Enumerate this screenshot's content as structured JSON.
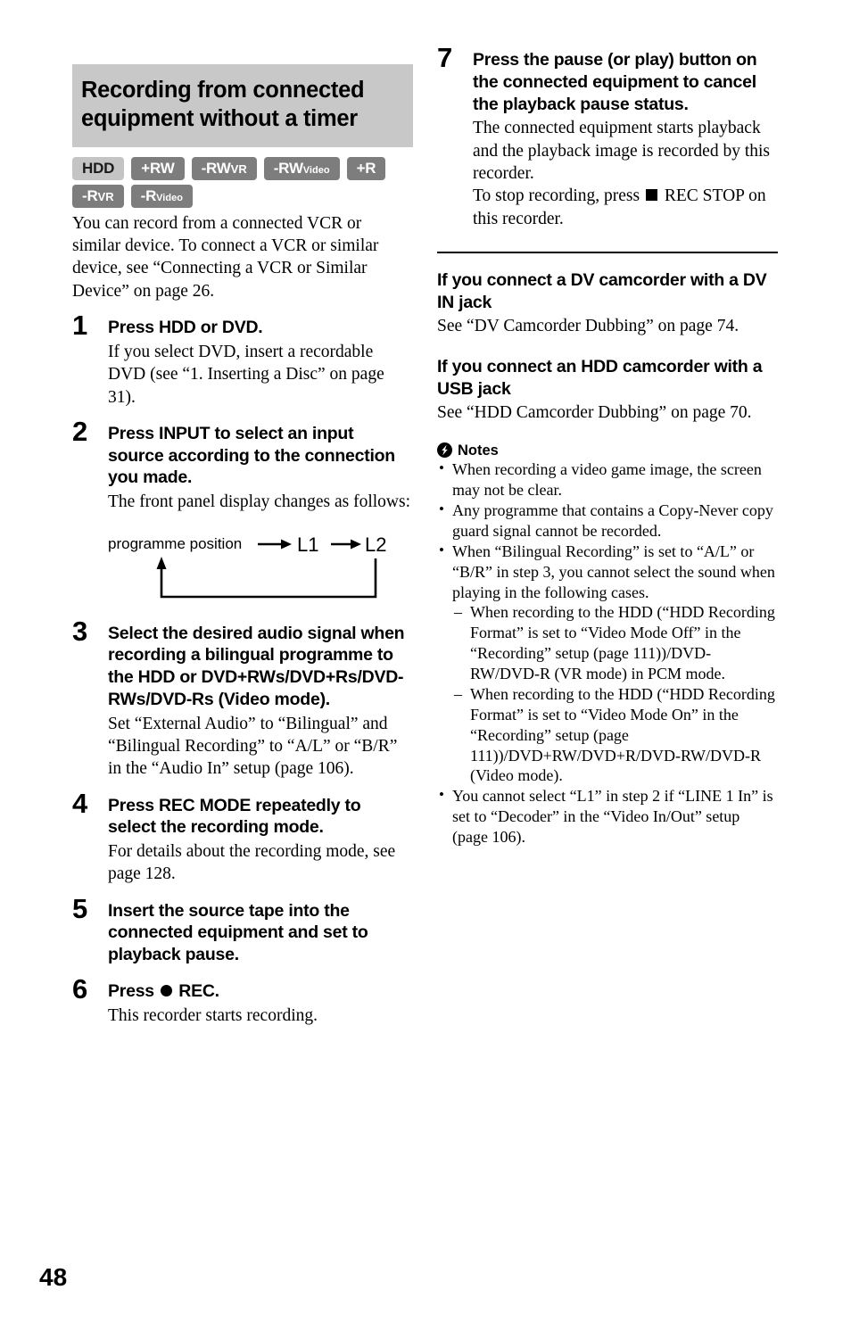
{
  "document": {
    "page_number": "48",
    "title": "Recording from connected equipment without a timer"
  },
  "media_badges": {
    "row1": [
      {
        "main": "HDD",
        "sub": "",
        "style": "light"
      },
      {
        "main": "+RW",
        "sub": "",
        "style": "dark"
      },
      {
        "main": "-RW",
        "sub": "VR",
        "style": "dark"
      },
      {
        "main": "-RW",
        "sub": "Video",
        "style": "dark"
      },
      {
        "main": "+R",
        "sub": "",
        "style": "dark"
      }
    ],
    "row2": [
      {
        "main": "-R",
        "sub": "VR",
        "style": "dark"
      },
      {
        "main": "-R",
        "sub": "Video",
        "style": "dark"
      }
    ]
  },
  "intro": "You can record from a connected VCR or similar device. To connect a VCR or similar device, see “Connecting a VCR or Similar Device” on page 26.",
  "steps": [
    {
      "num": "1",
      "head": "Press HDD or DVD.",
      "body": "If you select DVD, insert a recordable DVD (see “1. Inserting a Disc” on page 31)."
    },
    {
      "num": "2",
      "head": "Press INPUT to select an input source according to the connection you made.",
      "body": "The front panel display changes as follows:"
    },
    {
      "num": "3",
      "head": "Select the desired audio signal when recording a bilingual programme to the HDD or DVD+RWs/DVD+Rs/DVD-RWs/DVD-Rs (Video mode).",
      "body": "Set “External Audio” to “Bilingual” and “Bilingual Recording” to “A/L” or “B/R” in the “Audio In” setup (page 106)."
    },
    {
      "num": "4",
      "head": "Press REC MODE repeatedly to select the recording mode.",
      "body": "For details about the recording mode, see page 128."
    },
    {
      "num": "5",
      "head": "Insert the source tape into the connected equipment and set to playback pause.",
      "body": ""
    },
    {
      "num": "6",
      "head_before": "Press",
      "head_after": "REC.",
      "head_glyph": "record-circle",
      "body": "This recorder starts recording."
    },
    {
      "num": "7",
      "head": "Press the pause (or play) button on the connected equipment to cancel the playback pause status.",
      "body_line1": "The connected equipment starts playback and the playback image is recorded by this recorder.",
      "body_line2_before": "To stop recording, press",
      "body_line2_glyph": "stop-square",
      "body_line2_after": "REC STOP on this recorder."
    }
  ],
  "flow_diagram": {
    "label": "programme position",
    "node1": "L1",
    "node2": "L2"
  },
  "subsections": [
    {
      "heading": "If you connect a DV camcorder with a DV IN jack",
      "body": "See “DV Camcorder Dubbing” on page 74."
    },
    {
      "heading": "If you connect an HDD camcorder with a USB jack",
      "body": "See “HDD Camcorder Dubbing” on page 70."
    }
  ],
  "notes": {
    "title": "Notes",
    "items": [
      {
        "text": "When recording a video game image, the screen may not be clear.",
        "subitems": []
      },
      {
        "text": "Any programme that contains a Copy-Never copy guard signal cannot be recorded.",
        "subitems": []
      },
      {
        "text": "When “Bilingual Recording” is set to “A/L” or “B/R” in step 3, you cannot select the sound when playing in the following cases.",
        "subitems": [
          "When recording to the HDD (“HDD Recording Format” is set to “Video Mode Off” in the “Recording” setup (page 111))/DVD-RW/DVD-R (VR mode) in PCM mode.",
          "When recording to the HDD (“HDD Recording Format” is set to “Video Mode On” in the “Recording” setup (page 111))/DVD+RW/DVD+R/DVD-RW/DVD-R (Video mode)."
        ]
      },
      {
        "text": "You cannot select “L1” in step 2 if “LINE 1 In” is set to “Decoder” in the “Video In/Out” setup (page 106).",
        "subitems": []
      }
    ]
  },
  "colors": {
    "title_band": "#c8c8c8",
    "badge_dark": "#7d7d7d",
    "badge_light": "#c4c4c4",
    "text": "#000000"
  }
}
